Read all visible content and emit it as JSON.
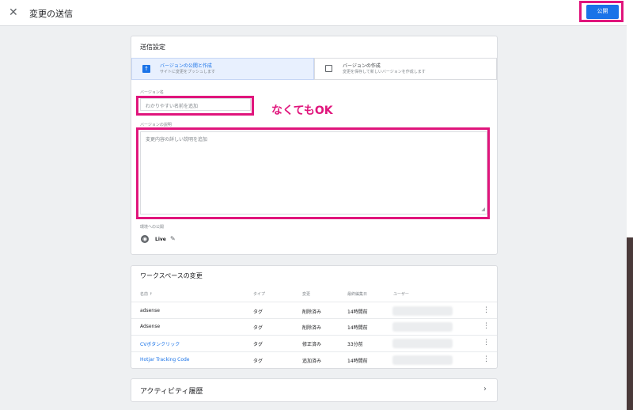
{
  "header": {
    "close_icon": "close-icon",
    "title": "変更の送信",
    "publish_label": "公開"
  },
  "settings": {
    "heading": "送信設定",
    "tab_publish": {
      "title": "バージョンの公開と作成",
      "subtitle": "サイトに変更をプッシュします"
    },
    "tab_create": {
      "title": "バージョンの作成",
      "subtitle": "変更を保存して新しいバージョンを作成します"
    },
    "version_name_label": "バージョン名",
    "version_name_placeholder": "わかりやすい名前を追加",
    "annotation": "なくてもOK",
    "version_desc_label": "バージョンの説明",
    "version_desc_placeholder": "変更内容の詳しい説明を追加",
    "env_label": "環境への公開",
    "env_name": "Live"
  },
  "workspace": {
    "heading": "ワークスペースの変更",
    "columns": [
      "名前 ↑",
      "タイプ",
      "変更",
      "最終編集日",
      "ユーザー"
    ],
    "rows": [
      {
        "name": "adsense",
        "type": "タグ",
        "change": "削除済み",
        "edited": "14時間前"
      },
      {
        "name": "Adsense",
        "type": "タグ",
        "change": "削除済み",
        "edited": "14時間前"
      },
      {
        "name": "CVボタンクリック",
        "type": "タグ",
        "change": "修正済み",
        "edited": "33分前"
      },
      {
        "name": "Hotjar Tracking Code",
        "type": "タグ",
        "change": "追加済み",
        "edited": "14時間前"
      }
    ]
  },
  "activity": {
    "title": "アクティビティ履歴"
  },
  "colors": {
    "accent": "#1a73e8",
    "highlight": "#e0157c"
  }
}
